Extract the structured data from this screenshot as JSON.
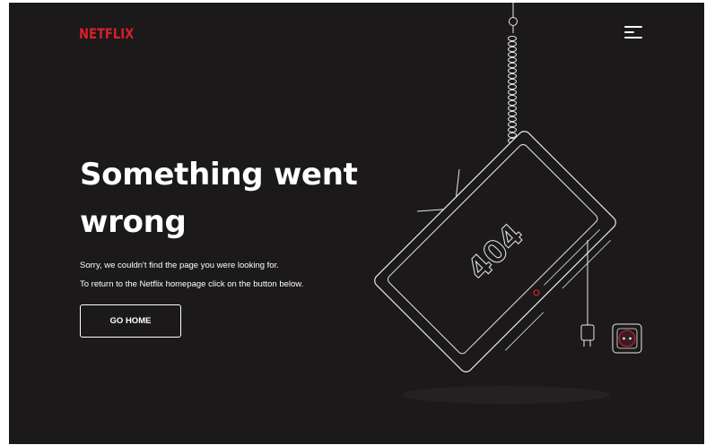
{
  "brand": {
    "logo_text": "NETFLIX",
    "accent_color": "#d6202b"
  },
  "header": {
    "menu_icon": "hamburger-menu-icon"
  },
  "main": {
    "headline": "Something went wrong",
    "message_line_1": "Sorry, we couldn't find the page you were looking for.",
    "message_line_2": "To return to the Netflix homepage click on the button below.",
    "home_button_label": "GO HOME"
  },
  "illustration": {
    "screen_text": "404",
    "icons": [
      "hanging-cable-icon",
      "tv-icon",
      "plug-icon",
      "power-socket-icon"
    ]
  },
  "colors": {
    "background": "#1b1919",
    "foreground": "#ffffff"
  }
}
